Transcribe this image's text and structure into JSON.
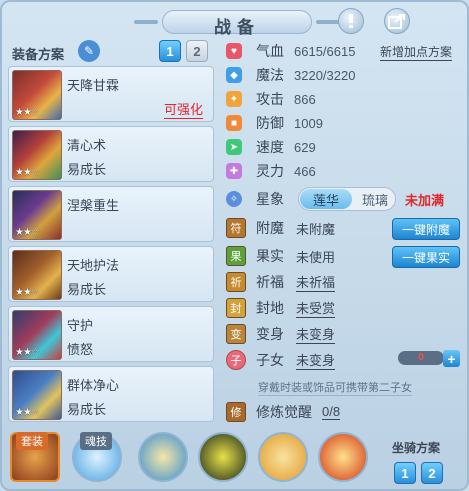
{
  "header": {
    "title": "战备",
    "help_icon": "help-icon",
    "share_icon": "share-icon"
  },
  "scheme": {
    "label": "装备方案",
    "tabs": [
      "1",
      "2"
    ],
    "active_tab": 0
  },
  "list": [
    {
      "name": "天降甘霖",
      "sub": "",
      "red": "可强化",
      "stars": "★★☆"
    },
    {
      "name": "清心术",
      "sub": "易成长",
      "red": "",
      "stars": "★★☆"
    },
    {
      "name": "涅槃重生",
      "sub": "",
      "red": "",
      "stars": "★★☆"
    },
    {
      "name": "天地护法",
      "sub": "易成长",
      "red": "",
      "stars": "★★☆"
    },
    {
      "name": "守护",
      "sub": "愤怒",
      "red": "",
      "stars": "★★☆"
    },
    {
      "name": "群体净心",
      "sub": "易成长",
      "red": "",
      "stars": "★★☆"
    }
  ],
  "stats": [
    {
      "label": "气血",
      "value": "6615/6615"
    },
    {
      "label": "魔法",
      "value": "3220/3220"
    },
    {
      "label": "攻击",
      "value": "866"
    },
    {
      "label": "防御",
      "value": "1009"
    },
    {
      "label": "速度",
      "value": "629"
    },
    {
      "label": "灵力",
      "value": "466"
    }
  ],
  "new_points": "新增加点方案",
  "star_sign": {
    "label": "星象",
    "on": "莲华",
    "off": "琉璃",
    "status": "未加满"
  },
  "rows": [
    {
      "label": "附魔",
      "value": "未附魔"
    },
    {
      "label": "果实",
      "value": "未使用"
    },
    {
      "label": "祈福",
      "value": "未祈福"
    },
    {
      "label": "封地",
      "value": "未受赏"
    },
    {
      "label": "变身",
      "value": "未变身"
    },
    {
      "label": "子女",
      "value": "未变身"
    }
  ],
  "buttons": {
    "one_key_enchant": "一键附魔",
    "one_key_fruit": "一键果实"
  },
  "child_count": "0",
  "child_fill_fraction": 0,
  "hint": "穿戴时装或饰品可携带第二子女",
  "awaken": {
    "label": "修炼觉醒",
    "value": "0/8"
  },
  "bottom": {
    "suit_tag": "套装",
    "soul_tag": "魂技",
    "mount_label": "坐骑方案",
    "mount_tabs": [
      "1",
      "2"
    ],
    "mount_active": 1
  }
}
